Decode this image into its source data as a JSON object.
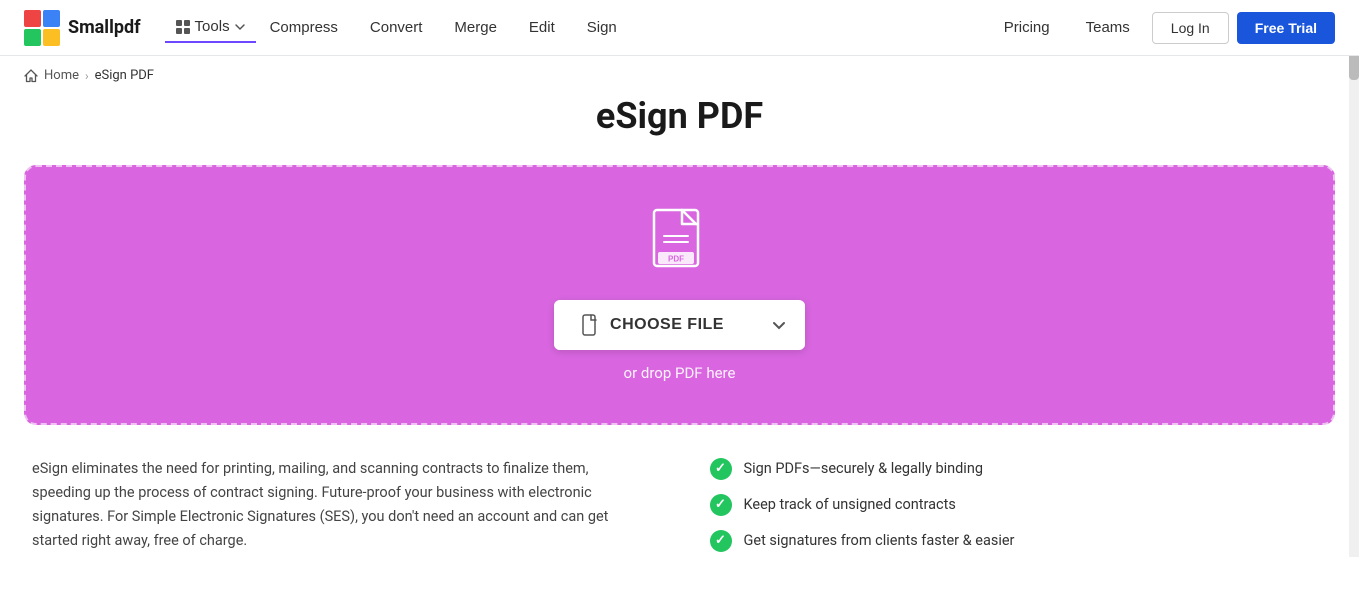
{
  "header": {
    "logo_text": "Smallpdf",
    "tools_label": "Tools",
    "nav_items": [
      {
        "label": "Compress",
        "name": "compress"
      },
      {
        "label": "Convert",
        "name": "convert"
      },
      {
        "label": "Merge",
        "name": "merge"
      },
      {
        "label": "Edit",
        "name": "edit"
      },
      {
        "label": "Sign",
        "name": "sign"
      }
    ],
    "right_items": [
      {
        "label": "Pricing",
        "name": "pricing"
      },
      {
        "label": "Teams",
        "name": "teams"
      }
    ],
    "login_label": "Log In",
    "free_trial_label": "Free Trial"
  },
  "breadcrumb": {
    "home": "Home",
    "current": "eSign PDF"
  },
  "main": {
    "page_title": "eSign PDF",
    "drop_zone": {
      "choose_file_label": "CHOOSE FILE",
      "drop_hint": "or drop PDF here"
    },
    "description": "eSign eliminates the need for printing, mailing, and scanning contracts to finalize them, speeding up the process of contract signing. Future-proof your business with electronic signatures. For Simple Electronic Signatures (SES), you don't need an account and can get started right away, free of charge.",
    "features": [
      {
        "text": "Sign PDFs—securely & legally binding"
      },
      {
        "text": "Keep track of unsigned contracts"
      },
      {
        "text": "Get signatures from clients faster & easier"
      }
    ]
  },
  "colors": {
    "purple": "#d966e0",
    "nav_underline": "#6c47ff",
    "cta_blue": "#1a56db",
    "green_check": "#22c55e"
  }
}
